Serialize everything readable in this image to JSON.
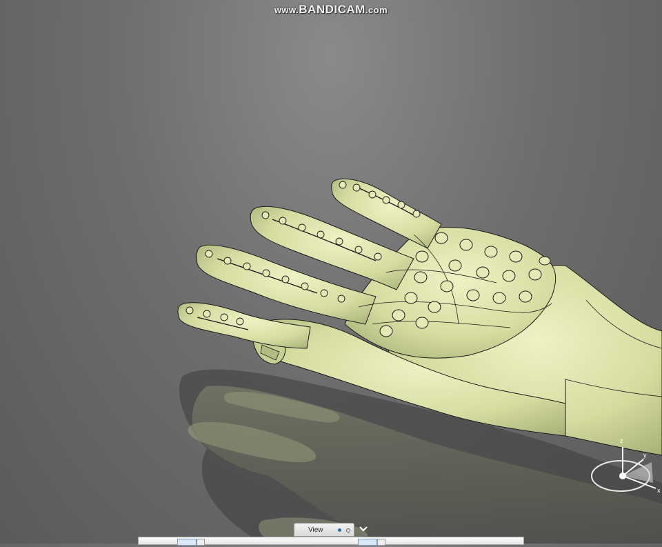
{
  "watermark": {
    "prefix": "www.",
    "brand": "BANDICAM",
    "suffix": ".com"
  },
  "view_tab": {
    "label": "View"
  },
  "compass": {
    "axis_z": "z",
    "axis_y": "y",
    "axis_x": "x"
  },
  "colors": {
    "model_fill": "#d9dfa6",
    "model_edge": "#1a1a1a",
    "background": "#6e6e6e",
    "tab_dot": "#2a6fb0"
  },
  "icons": [
    "chevron-down-icon",
    "compass-icon"
  ]
}
